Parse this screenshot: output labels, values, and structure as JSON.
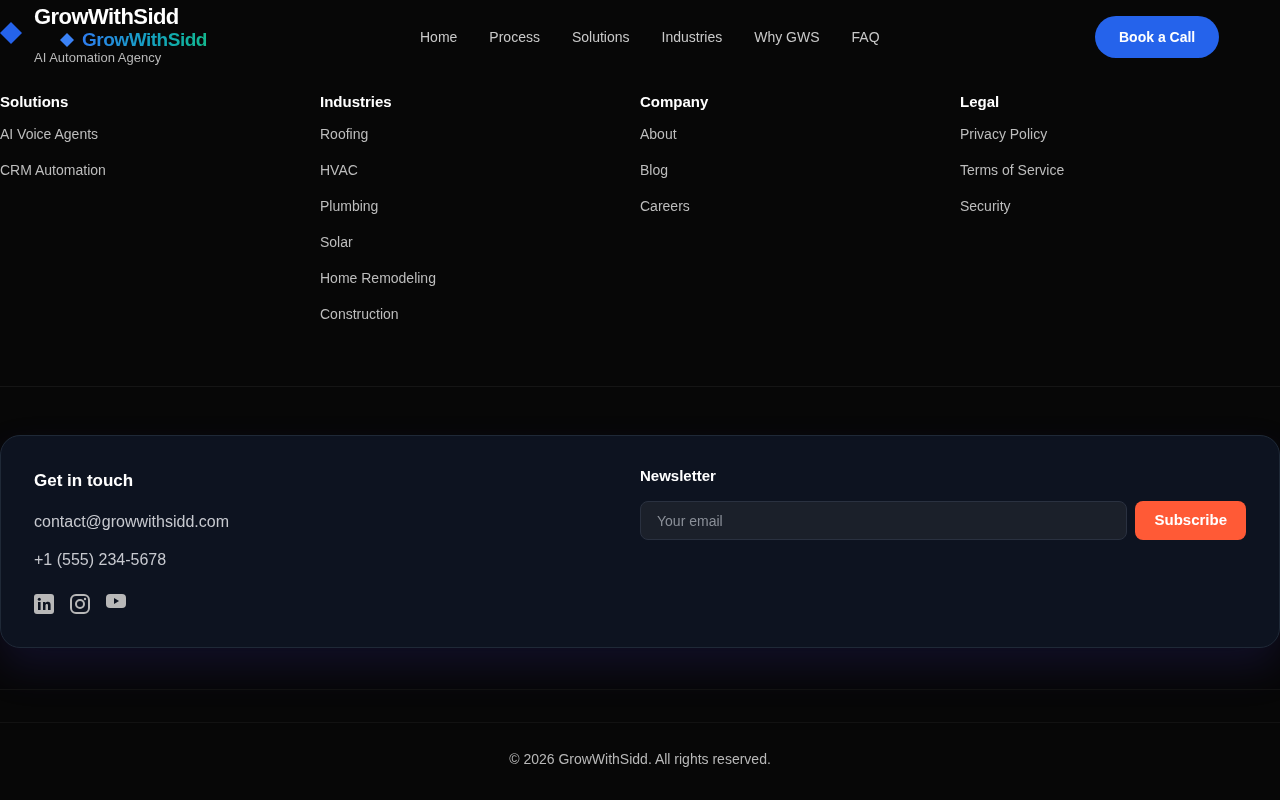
{
  "header": {
    "logo": {
      "name": "GrowWithSidd",
      "tagline": "AI Automation Agency"
    },
    "logo_overlay": {
      "name": "GrowWithSidd"
    },
    "nav": [
      "Home",
      "Process",
      "Solutions",
      "Industries",
      "Why GWS",
      "FAQ"
    ],
    "cta": "Book a Call"
  },
  "footer_columns": [
    {
      "heading": "Solutions",
      "links": [
        "AI Voice Agents",
        "CRM Automation"
      ]
    },
    {
      "heading": "Industries",
      "links": [
        "Roofing",
        "HVAC",
        "Plumbing",
        "Solar",
        "Home Remodeling",
        "Construction"
      ]
    },
    {
      "heading": "Company",
      "links": [
        "About",
        "Blog",
        "Careers"
      ]
    },
    {
      "heading": "Legal",
      "links": [
        "Privacy Policy",
        "Terms of Service",
        "Security"
      ]
    }
  ],
  "contact": {
    "heading": "Get in touch",
    "email": "contact@growwithsidd.com",
    "phone": "+1 (555) 234-5678"
  },
  "newsletter": {
    "heading": "Newsletter",
    "placeholder": "Your email",
    "button": "Subscribe"
  },
  "copyright": "© 2026 GrowWithSidd. All rights reserved."
}
